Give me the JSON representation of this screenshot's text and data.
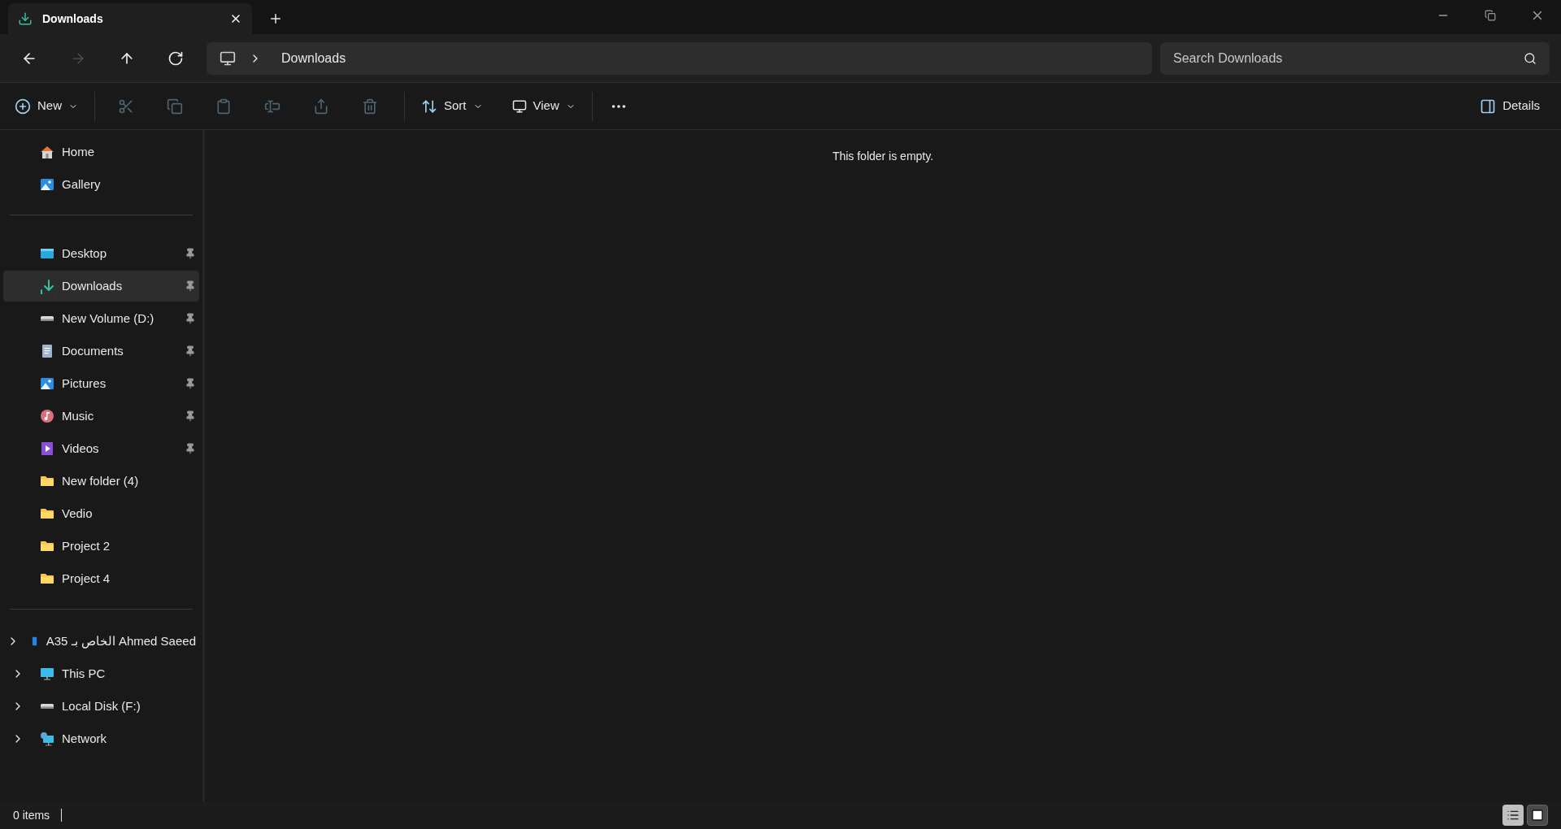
{
  "tabs": [
    {
      "label": "Downloads",
      "selected": true
    }
  ],
  "nav": [
    {
      "kind": "back",
      "disabled": false
    },
    {
      "kind": "forward",
      "disabled": true
    },
    {
      "kind": "up",
      "disabled": false
    },
    {
      "kind": "refresh",
      "disabled": false
    }
  ],
  "breadcrumb": [
    "Downloads"
  ],
  "search": {
    "placeholder": "Search Downloads"
  },
  "toolbar": {
    "new": "New",
    "actions": [
      {
        "kind": "cut",
        "disabled": true
      },
      {
        "kind": "copy",
        "disabled": true
      },
      {
        "kind": "paste",
        "disabled": true
      },
      {
        "kind": "rename",
        "disabled": true
      },
      {
        "kind": "share",
        "disabled": true
      },
      {
        "kind": "delete",
        "disabled": true
      }
    ],
    "sort": "Sort",
    "view": "View",
    "details": "Details"
  },
  "sidebar": {
    "groups": [
      [
        {
          "label": "Home",
          "kind": "home",
          "selected": false
        },
        {
          "label": "Gallery",
          "kind": "gallery",
          "selected": false
        }
      ],
      [
        {
          "label": "Desktop",
          "kind": "desktop",
          "selected": false,
          "pinned": true
        },
        {
          "label": "Downloads",
          "kind": "download",
          "selected": true,
          "pinned": true
        },
        {
          "label": "New Volume (D:)",
          "kind": "drive",
          "selected": false,
          "pinned": true
        },
        {
          "label": "Documents",
          "kind": "documents",
          "selected": false,
          "pinned": true
        },
        {
          "label": "Pictures",
          "kind": "pictures",
          "selected": false,
          "pinned": true
        },
        {
          "label": "Music",
          "kind": "music",
          "selected": false,
          "pinned": true
        },
        {
          "label": "Videos",
          "kind": "videos",
          "selected": false,
          "pinned": true
        },
        {
          "label": "New folder (4)",
          "kind": "folder",
          "selected": false,
          "pinned": false
        },
        {
          "label": "Vedio",
          "kind": "folder",
          "selected": false,
          "pinned": false
        },
        {
          "label": "Project 2",
          "kind": "folder",
          "selected": false,
          "pinned": false
        },
        {
          "label": "Project 4",
          "kind": "folder",
          "selected": false,
          "pinned": false
        }
      ],
      [
        {
          "label": "A35 الخاص بـ Ahmed Saeed",
          "kind": "phone",
          "selected": false,
          "expanded": false
        },
        {
          "label": "This PC",
          "kind": "pc",
          "selected": false,
          "expanded": false
        },
        {
          "label": "Local Disk (F:)",
          "kind": "drive",
          "selected": false,
          "expanded": false
        },
        {
          "label": "Network",
          "kind": "network",
          "selected": false,
          "expanded": false
        }
      ]
    ]
  },
  "content": {
    "empty_message": "This folder is empty."
  },
  "status_bar": {
    "count": "0 items",
    "views": [
      {
        "kind": "details",
        "selected": false
      },
      {
        "kind": "tiles",
        "selected": true
      }
    ]
  }
}
